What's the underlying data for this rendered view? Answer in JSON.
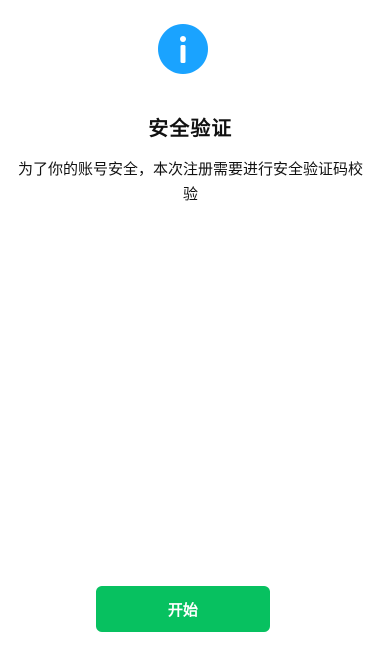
{
  "icon": {
    "name": "info-icon",
    "color": "#1aa3ff"
  },
  "title": "安全验证",
  "description": "为了你的账号安全，本次注册需要进行安全验证码校验",
  "start_button": {
    "label": "开始",
    "color": "#07c160"
  }
}
